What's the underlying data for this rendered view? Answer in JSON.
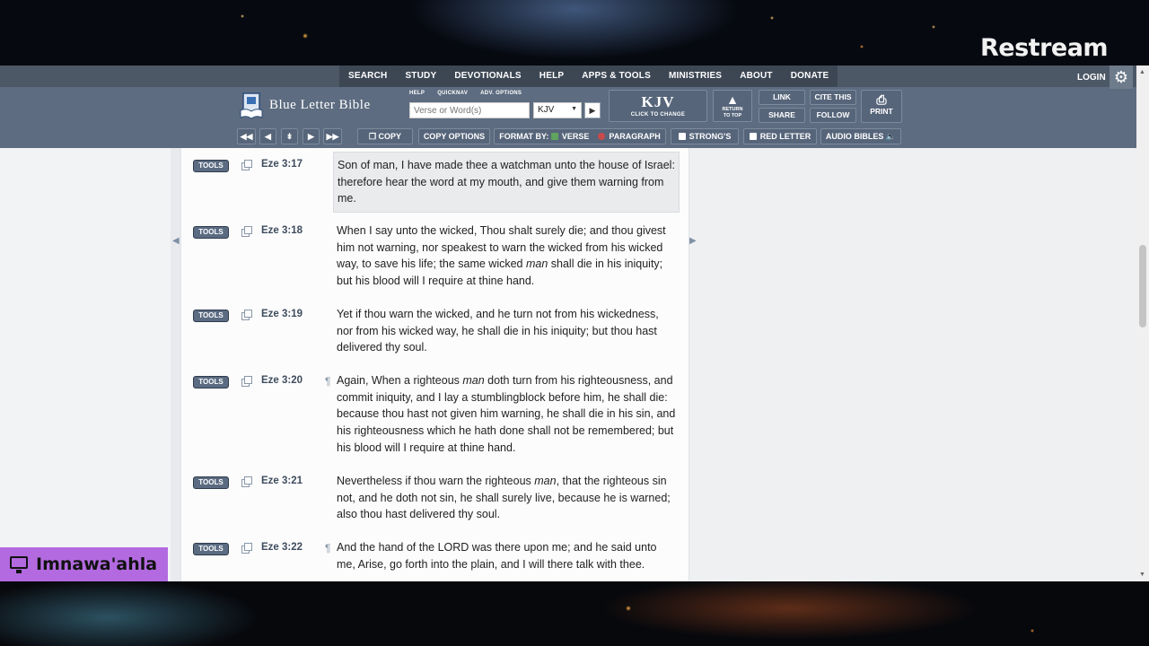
{
  "overlay": {
    "brand": "Restream",
    "streamer_name": "Imnawa'ahla"
  },
  "topnav": {
    "items": [
      "SEARCH",
      "STUDY",
      "DEVOTIONALS",
      "HELP",
      "APPS & TOOLS",
      "MINISTRIES",
      "ABOUT",
      "DONATE"
    ],
    "login": "LOGIN"
  },
  "header": {
    "logo": "Blue Letter Bible",
    "mini_links": [
      "HELP",
      "QUICKNAV",
      "ADV. OPTIONS"
    ],
    "search_placeholder": "Verse or Word(s)",
    "version_selected": "KJV",
    "version_big": "KJV",
    "version_hint": "CLICK TO CHANGE",
    "return_to_top_1": "RETURN",
    "return_to_top_2": "TO TOP",
    "link": "LINK",
    "share": "SHARE",
    "cite": "CITE THIS",
    "follow": "FOLLOW",
    "print": "PRINT"
  },
  "toolbar": {
    "copy": "COPY",
    "copy_options": "COPY OPTIONS",
    "format_by": "FORMAT BY:",
    "verse": "VERSE",
    "paragraph": "PARAGRAPH",
    "strongs": "STRONG'S",
    "red_letter": "RED LETTER",
    "audio_bibles": "AUDIO BIBLES"
  },
  "tools_label": "TOOLS",
  "verses": [
    {
      "ref": "Eze 3:17",
      "pilcrow": "",
      "text": "Son of man, I have made thee a watchman unto the house of Israel: therefore hear the word at my mouth, and give them warning from me."
    },
    {
      "ref": "Eze 3:18",
      "pilcrow": "",
      "text_a": "When I say unto the wicked, Thou shalt surely die; and thou givest him not warning, nor speakest to warn the wicked from his wicked way, to save his life; the same wicked ",
      "italic": "man",
      "text_b": " shall die in his iniquity; but his blood will I require at thine hand."
    },
    {
      "ref": "Eze 3:19",
      "pilcrow": "",
      "text": "Yet if thou warn the wicked, and he turn not from his wickedness, nor from his wicked way, he shall die in his iniquity; but thou hast delivered thy soul."
    },
    {
      "ref": "Eze 3:20",
      "pilcrow": "¶",
      "text_a": "Again, When a righteous ",
      "italic": "man",
      "text_b": " doth turn from his righteousness, and commit iniquity, and I lay a stumblingblock before him, he shall die: because thou hast not given him warning, he shall die in his sin, and his righteousness which he hath done shall not be remembered; but his blood will I require at thine hand."
    },
    {
      "ref": "Eze 3:21",
      "pilcrow": "",
      "text_a": "Nevertheless if thou warn the righteous ",
      "italic": "man",
      "text_b": ", that the righteous sin not, and he doth not sin, he shall surely live, because he is warned; also thou hast delivered thy soul."
    },
    {
      "ref": "Eze 3:22",
      "pilcrow": "¶",
      "text": "And the hand of the LORD was there upon me; and he said unto me, Arise, go forth into the plain, and I will there talk with thee."
    }
  ],
  "colors": {
    "header_bg": "#5d6c80",
    "topnav_bg": "#4d5866",
    "overlay_badge": "#b36ae0"
  }
}
